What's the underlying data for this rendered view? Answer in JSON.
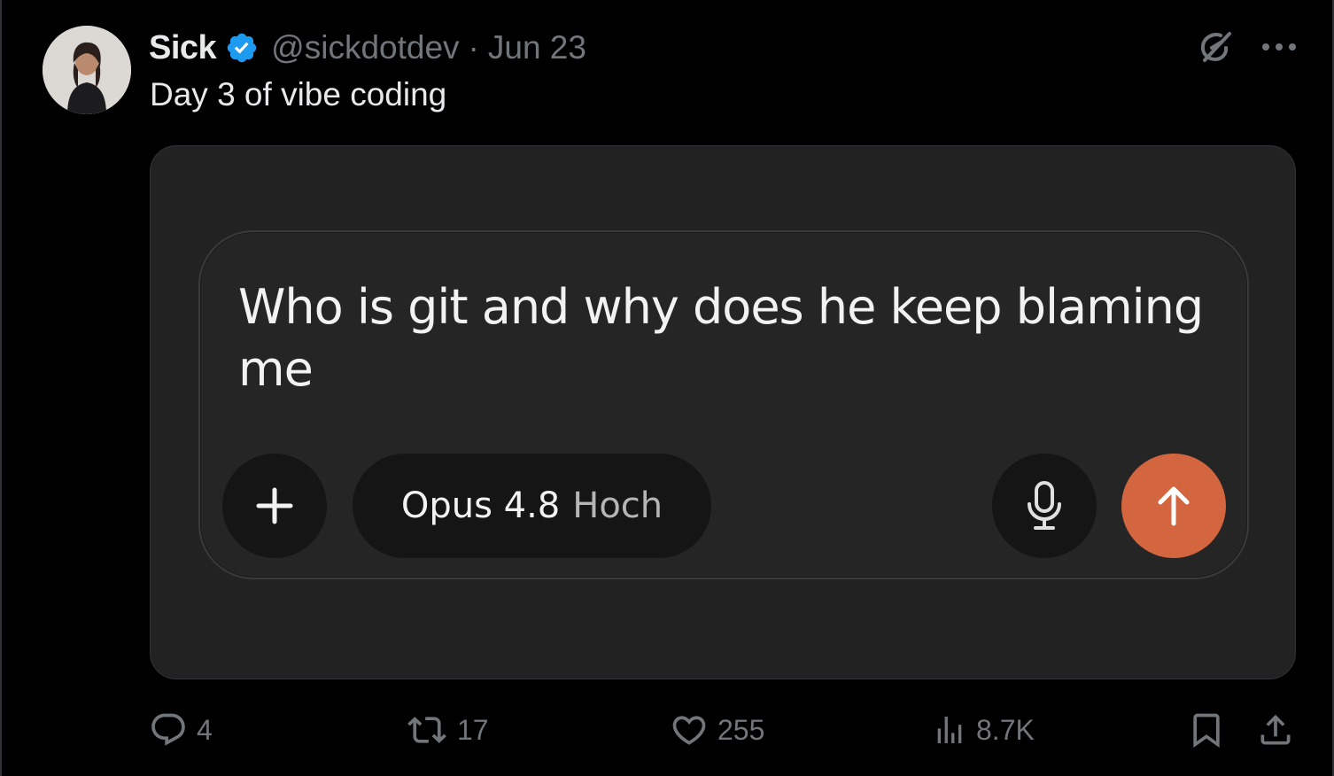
{
  "author": {
    "name": "Sick",
    "handle": "@sickdotdev",
    "separator": "·",
    "date": "Jun 23",
    "verified": true
  },
  "tweet": {
    "text": "Day 3 of vibe coding"
  },
  "media": {
    "composer_text": "Who is git and why does he keep blaming me",
    "model_name": "Opus 4.8",
    "model_tier": "Hoch",
    "send_color": "#d4663f"
  },
  "actions": {
    "replies": "4",
    "reposts": "17",
    "likes": "255",
    "views": "8.7K"
  },
  "colors": {
    "background": "#000000",
    "verified": "#1d9bf0",
    "muted": "#71767b"
  },
  "icons": [
    "verified-badge-icon",
    "grok-icon",
    "more-icon",
    "plus-icon",
    "mic-icon",
    "arrow-up-icon",
    "reply-icon",
    "repost-icon",
    "like-icon",
    "views-icon",
    "bookmark-icon",
    "share-icon"
  ]
}
